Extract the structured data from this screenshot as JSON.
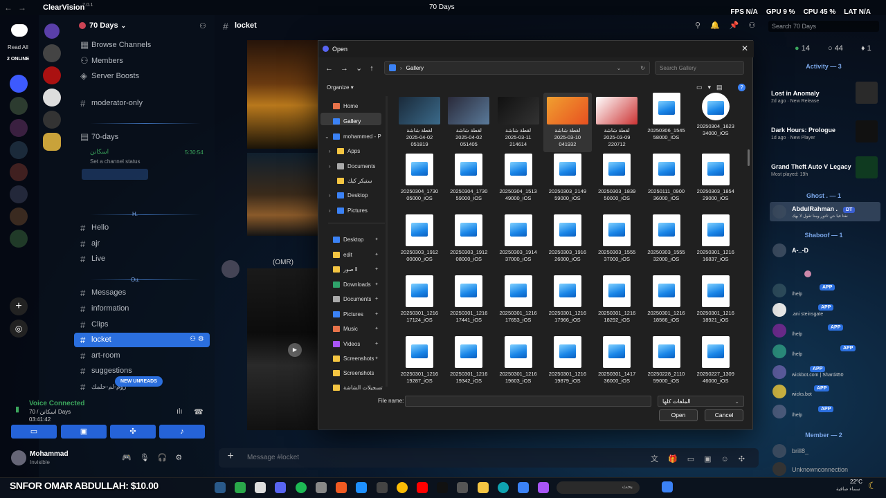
{
  "titlebar": {
    "app": "ClearVision",
    "version": "7.0.1",
    "window_title": "70 Days",
    "stats": [
      {
        "label": "FPS",
        "value": "N/A"
      },
      {
        "label": "GPU",
        "value": "9 %"
      },
      {
        "label": "CPU",
        "value": "45 %"
      },
      {
        "label": "LAT",
        "value": "N/A"
      }
    ]
  },
  "rail": {
    "read_all": "Read All",
    "online": "2 ONLINE"
  },
  "sidebar": {
    "guild": "70 Days",
    "top_items": [
      "Browse Channels",
      "Members",
      "Server Boosts"
    ],
    "channels": {
      "moderator": "moderator-only",
      "days": "70-days",
      "user_label": "اسكانن",
      "user_time": "5:30:54",
      "status_hint": "Set a channel status",
      "h_group": [
        "Hello",
        "ajr",
        "Live"
      ],
      "ou_group": [
        "Messages",
        "information",
        "Clips",
        "locket",
        "art-room",
        "suggestions"
      ],
      "cut": "روم-لم-حلمك"
    },
    "sep_labels": [
      "H.",
      "Ou."
    ],
    "new_unreads": "NEW UNREADS",
    "voice": {
      "title": "Voice Connected",
      "channel": "70 / اسكانن Days",
      "timer": "03:41:42"
    },
    "user": {
      "name": "Mohammad",
      "status": "Invisible"
    }
  },
  "chat": {
    "channel": "locket",
    "search_placeholder": "Search 70 Days",
    "composer_placeholder": "Message #locket",
    "omr": "(OMR)"
  },
  "members": {
    "counts": [
      "14",
      "44",
      "1"
    ],
    "activity_header": "Activity — 3",
    "activities": [
      {
        "title": "Lost in Anomaly",
        "meta": "2d ago · New Release"
      },
      {
        "title": "Dark Hours: Prologue",
        "meta": "1d ago · New Player"
      },
      {
        "title": "Grand Theft Auto V Legacy",
        "meta": "Most played: 19h"
      }
    ],
    "ghost_header": "Ghost . — 1",
    "ghost_user": "AbdulRahman .",
    "ghost_tag": "DT",
    "ghost_sub": "نفتا فيا حن ثاتور ومنا تقول لا بهك",
    "shaboof_header": "Shaboof — 1",
    "shaboof_user": "A-_-D",
    "app_label": "APP",
    "bots": [
      "/help",
      ".ani steinsgate",
      "/help",
      "/help",
      "wickbot.com | Shard450",
      "wicks.bot",
      "/help"
    ],
    "member_header": "Member — 2",
    "member_users": [
      "brill8_",
      "Unknownconnection"
    ]
  },
  "dialog": {
    "title": "Open",
    "address": "Gallery",
    "search": "Search Gallery",
    "organize": "Organize",
    "nav": [
      "Home",
      "Gallery",
      "mohammed - P",
      "Apps",
      "Documents",
      "ستيكر كيك",
      "Desktop",
      "Pictures",
      "Desktop",
      "edit",
      "صور ll",
      "Downloads",
      "Documents",
      "Pictures",
      "Music",
      "Videos",
      "Screenshots",
      "Screenshots",
      "تسجيلات الشاشة"
    ],
    "files": [
      [
        "لقطة شاشة",
        "2025-04-02",
        "051819"
      ],
      [
        "لقطة شاشة",
        "2025-04-02",
        "051405"
      ],
      [
        "لقطة شاشة",
        "2025-03-11",
        "214614"
      ],
      [
        "لقطة شاشة",
        "2025-03-10",
        "041932"
      ],
      [
        "لقطة شاشة",
        "2025-03-09",
        "220712"
      ],
      [
        "20250306_1545",
        "58000_iOS",
        ""
      ],
      [
        "20250304_1623",
        "34000_iOS",
        ""
      ],
      [
        "20250304_1730",
        "05000_iOS",
        ""
      ],
      [
        "20250304_1730",
        "59000_iOS",
        ""
      ],
      [
        "20250304_1513",
        "49000_iOS",
        ""
      ],
      [
        "20250303_2149",
        "59000_iOS",
        ""
      ],
      [
        "20250303_1839",
        "50000_iOS",
        ""
      ],
      [
        "20250111_0900",
        "36000_iOS",
        ""
      ],
      [
        "20250303_1854",
        "29000_iOS",
        ""
      ],
      [
        "20250303_1912",
        "00000_iOS",
        ""
      ],
      [
        "20250303_1912",
        "08000_iOS",
        ""
      ],
      [
        "20250303_1914",
        "37000_iOS",
        ""
      ],
      [
        "20250303_1916",
        "26000_iOS",
        ""
      ],
      [
        "20250303_1555",
        "37000_iOS",
        ""
      ],
      [
        "20250303_1555",
        "32000_iOS",
        ""
      ],
      [
        "20250301_1216",
        "16837_iOS",
        ""
      ],
      [
        "20250301_1216",
        "17124_iOS",
        ""
      ],
      [
        "20250301_1216",
        "17441_iOS",
        ""
      ],
      [
        "20250301_1216",
        "17653_iOS",
        ""
      ],
      [
        "20250301_1216",
        "17966_iOS",
        ""
      ],
      [
        "20250301_1216",
        "18292_iOS",
        ""
      ],
      [
        "20250301_1216",
        "18566_iOS",
        ""
      ],
      [
        "20250301_1216",
        "18921_iOS",
        ""
      ],
      [
        "20250301_1216",
        "19287_iOS",
        ""
      ],
      [
        "20250301_1216",
        "19342_iOS",
        ""
      ],
      [
        "20250301_1216",
        "19603_iOS",
        ""
      ],
      [
        "20250301_1216",
        "19879_iOS",
        ""
      ],
      [
        "20250301_1417",
        "36000_iOS",
        ""
      ],
      [
        "20250228_2110",
        "59000_iOS",
        ""
      ],
      [
        "20250227_1309",
        "46000_iOS",
        ""
      ]
    ],
    "filename_label": "File name:",
    "filetype": "الملفات كلها",
    "open_btn": "Open",
    "cancel_btn": "Cancel"
  },
  "taskbar": {
    "promo": "SNFOR OMAR ABDULLAH: $10.00",
    "search": "بحث",
    "temp": "22°C",
    "weather": "سماء صافية"
  }
}
